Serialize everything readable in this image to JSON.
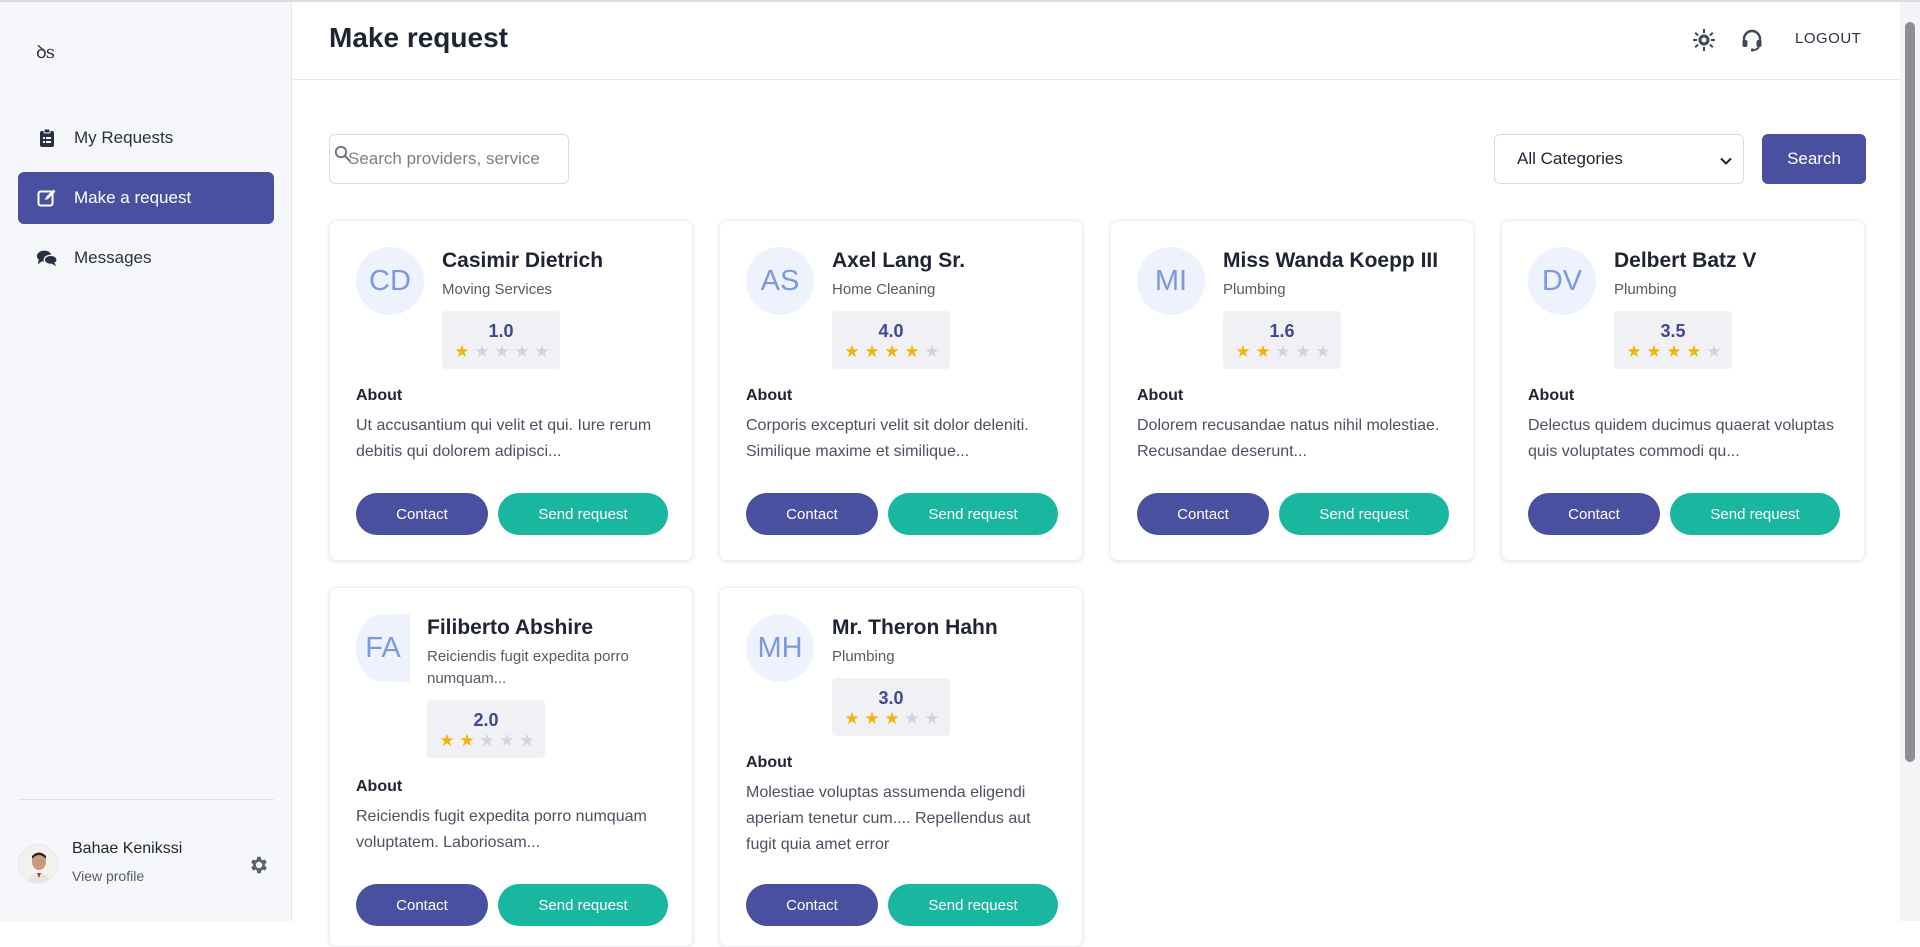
{
  "app": {
    "logo_text": "ꝺs"
  },
  "sidebar": {
    "items": [
      {
        "label": "My Requests",
        "icon": "clipboard-icon",
        "active": false
      },
      {
        "label": "Make a request",
        "icon": "edit-icon",
        "active": true
      },
      {
        "label": "Messages",
        "icon": "chat-icon",
        "active": false
      }
    ],
    "user": {
      "name": "Bahae Kenikssi",
      "link": "View profile"
    }
  },
  "header": {
    "title": "Make request",
    "logout": "LOGOUT"
  },
  "search": {
    "placeholder": "Search providers, service",
    "category_selected": "All Categories",
    "button": "Search"
  },
  "labels": {
    "about": "About",
    "contact": "Contact",
    "send_request": "Send request"
  },
  "colors": {
    "primary": "#4a50a0",
    "accent": "#19b6a0",
    "star": "#f2b406"
  },
  "providers": [
    {
      "initials": "CD",
      "name": "Casimir Dietrich",
      "category": "Moving Services",
      "rating": "1.0",
      "stars": 1,
      "about": "Ut accusantium qui velit et qui. Iure rerum debitis qui dolorem adipisci..."
    },
    {
      "initials": "AS",
      "name": "Axel Lang Sr.",
      "category": "Home Cleaning",
      "rating": "4.0",
      "stars": 4,
      "about": "Corporis excepturi velit sit dolor deleniti. Similique maxime et similique..."
    },
    {
      "initials": "MI",
      "name": "Miss Wanda Koepp III",
      "category": "Plumbing",
      "rating": "1.6",
      "stars": 2,
      "about": "Dolorem recusandae natus nihil molestiae. Recusandae deserunt..."
    },
    {
      "initials": "DV",
      "name": "Delbert Batz V",
      "category": "Plumbing",
      "rating": "3.5",
      "stars": 4,
      "about": "Delectus quidem ducimus quaerat voluptas quis voluptates commodi qu..."
    },
    {
      "initials": "FA",
      "name": "Filiberto Abshire",
      "category": "Reiciendis fugit expedita porro numquam...",
      "rating": "2.0",
      "stars": 2,
      "about": "Reiciendis fugit expedita porro numquam voluptatem. Laboriosam..."
    },
    {
      "initials": "MH",
      "name": "Mr. Theron Hahn",
      "category": "Plumbing",
      "rating": "3.0",
      "stars": 3,
      "about": "Molestiae voluptas assumenda eligendi aperiam tenetur cum.... Repellendus aut fugit quia amet error"
    }
  ]
}
